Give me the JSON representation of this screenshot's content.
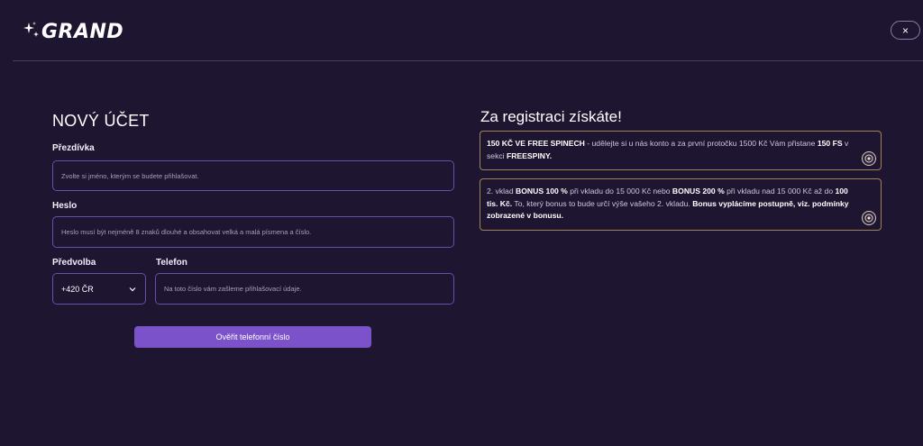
{
  "header": {
    "logo_text": "GRAND",
    "close_label": "×"
  },
  "form": {
    "title": "NOVÝ ÚČET",
    "nickname": {
      "label": "Přezdívka",
      "placeholder": "Zvolte si jméno, kterým se budete přihlašovat."
    },
    "password": {
      "label": "Heslo",
      "placeholder": "Heslo musí být nejméně 8 znaků dlouhé a obsahovat velká a malá písmena a číslo."
    },
    "prefix": {
      "label": "Předvolba",
      "value": "+420 ČR"
    },
    "phone": {
      "label": "Telefon",
      "placeholder": "Na toto číslo vám zašleme přihlašovací údaje."
    },
    "submit_label": "Ověřit telefonní číslo"
  },
  "bonus": {
    "title": "Za registraci získáte!",
    "card1": {
      "strong1": "150 KČ VE FREE SPINECH",
      "text1": " - udělejte si u nás konto a za první protočku 1500 Kč Vám přistane ",
      "strong2": "150 FS",
      "text2": " v sekci ",
      "strong3": "FREESPINY."
    },
    "card2": {
      "text1": "2. vklad ",
      "strong1": "BONUS 100 %",
      "text2": " při vkladu do 15 000 Kč nebo ",
      "strong2": "BONUS 200 %",
      "text3": " při vkladu nad 15 000 Kč až do ",
      "strong3": "100 tis. Kč.",
      "text4": " To, který bonus to bude určí výše vašeho 2. vkladu. ",
      "strong4": "Bonus vyplácíme postupně, viz. podmínky zobrazené v bonusu."
    }
  },
  "colors": {
    "background": "#1e1530",
    "accent": "#7b52c9",
    "field_border": "#6a4fa8",
    "card_border": "#a08458"
  }
}
